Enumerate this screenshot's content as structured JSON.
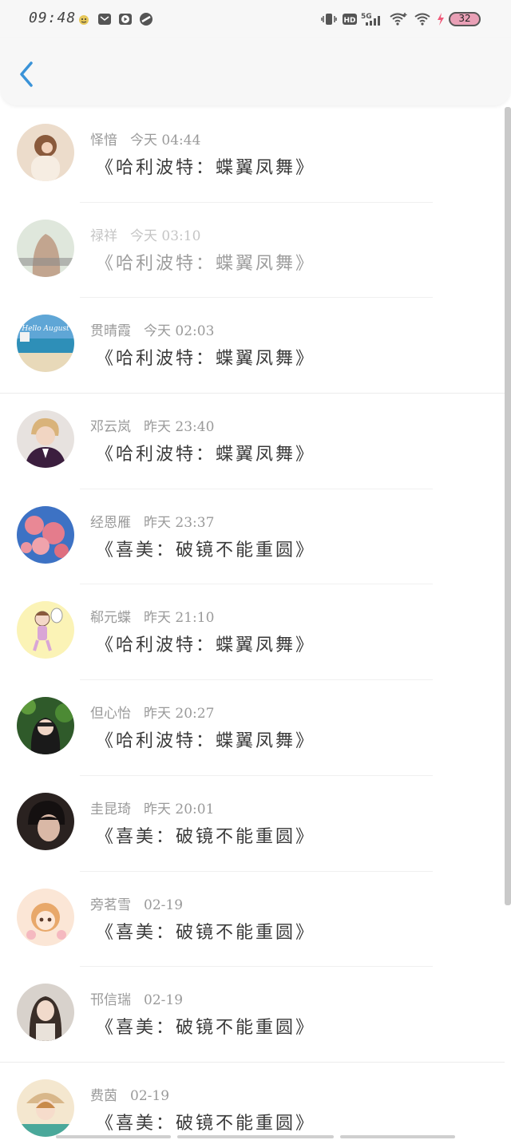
{
  "status_bar": {
    "time": "09:48",
    "battery": "32",
    "icons": [
      "emoji-face-icon",
      "mail-icon",
      "play-icon",
      "link-icon",
      "vibrate-icon",
      "hd-icon",
      "5g-signal-icon",
      "wifi-icon",
      "wifi-icon",
      "charging-icon"
    ]
  },
  "header": {
    "back_icon": "chevron-left-icon"
  },
  "colors": {
    "accent": "#3a93d8",
    "meta": "#9a9a9a",
    "title": "#3a3a3a"
  },
  "items": [
    {
      "name": "怿愔",
      "time": "今天 04:44",
      "title": "《哈利波特：蝶翼凤舞》"
    },
    {
      "name": "禄祥",
      "time": "今天 03:10",
      "title": "《哈利波特：蝶翼凤舞》"
    },
    {
      "name": "贯晴霞",
      "time": "今天 02:03",
      "title": "《哈利波特：蝶翼凤舞》"
    },
    {
      "name": "邓云岚",
      "time": "昨天 23:40",
      "title": "《哈利波特：蝶翼凤舞》"
    },
    {
      "name": "经恩雁",
      "time": "昨天 23:37",
      "title": "《喜美：破镜不能重圆》"
    },
    {
      "name": "郗元蝶",
      "time": "昨天 21:10",
      "title": "《哈利波特：蝶翼凤舞》"
    },
    {
      "name": "但心怡",
      "time": "昨天 20:27",
      "title": "《哈利波特：蝶翼凤舞》"
    },
    {
      "name": "圭昆琦",
      "time": "昨天 20:01",
      "title": "《喜美：破镜不能重圆》"
    },
    {
      "name": "旁茗雪",
      "time": "02-19",
      "title": "《喜美：破镜不能重圆》"
    },
    {
      "name": "邗信瑞",
      "time": "02-19",
      "title": "《喜美：破镜不能重圆》"
    },
    {
      "name": "费茵",
      "time": "02-19",
      "title": "《喜美：破镜不能重圆》"
    }
  ]
}
